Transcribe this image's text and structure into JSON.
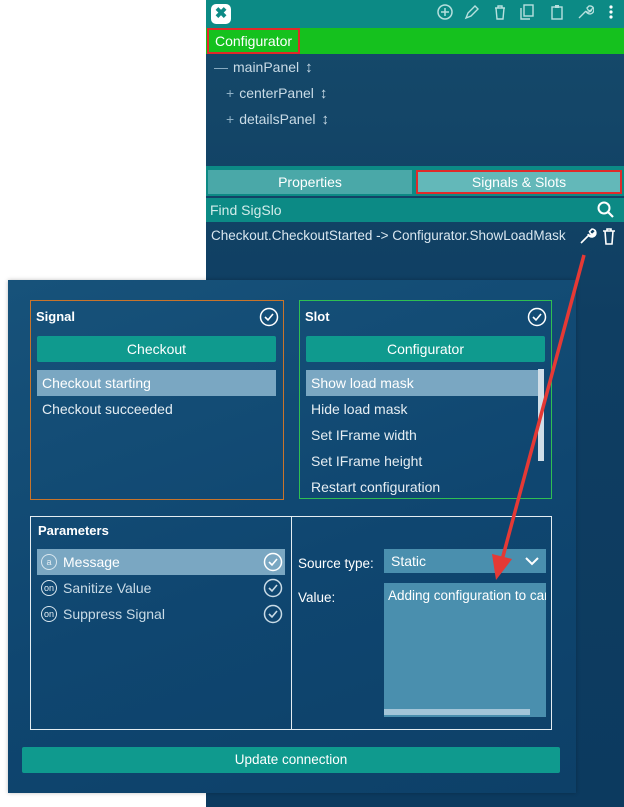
{
  "toolbar": {
    "logo": "✖",
    "icons": [
      "add-icon",
      "edit-icon",
      "delete-icon",
      "copy-icon",
      "paste-icon",
      "wrench-icon",
      "more-vertical-icon"
    ]
  },
  "tree": {
    "root_label": "Configurator",
    "items": [
      {
        "glyph": "—",
        "label": "mainPanel",
        "resize": "↕"
      },
      {
        "glyph": "+",
        "label": "centerPanel",
        "resize": "↕"
      },
      {
        "glyph": "+",
        "label": "detailsPanel",
        "resize": "↕"
      }
    ]
  },
  "tabs": {
    "properties": "Properties",
    "signals_slots": "Signals & Slots"
  },
  "search": {
    "placeholder": "Find SigSlo"
  },
  "connection": {
    "text": "Checkout.CheckoutStarted -> Configurator.ShowLoadMask"
  },
  "dialog": {
    "signal": {
      "title": "Signal",
      "component": "Checkout",
      "items": [
        "Checkout starting",
        "Checkout succeeded"
      ],
      "selected_index": 0
    },
    "slot": {
      "title": "Slot",
      "component": "Configurator",
      "items": [
        "Show load mask",
        "Hide load mask",
        "Set IFrame width",
        "Set IFrame height",
        "Restart configuration"
      ],
      "selected_index": 0
    },
    "parameters": {
      "title": "Parameters",
      "items": [
        {
          "badge": "a",
          "label": "Message"
        },
        {
          "badge": "on",
          "label": "Sanitize Value"
        },
        {
          "badge": "on",
          "label": "Suppress Signal"
        }
      ],
      "selected_index": 0,
      "source_type_label": "Source type:",
      "source_type_value": "Static",
      "value_label": "Value:",
      "value_text": "Adding configuration to cart..."
    },
    "update_button": "Update connection"
  },
  "colors": {
    "toolbar": "#0c8a85",
    "configurator_bar": "#15c11e",
    "highlight_border": "#e02a2a",
    "signal_border": "#c8742b",
    "slot_border": "#2fbf52",
    "button": "#0f9a8e",
    "selected_row": "#7aa7c2"
  }
}
